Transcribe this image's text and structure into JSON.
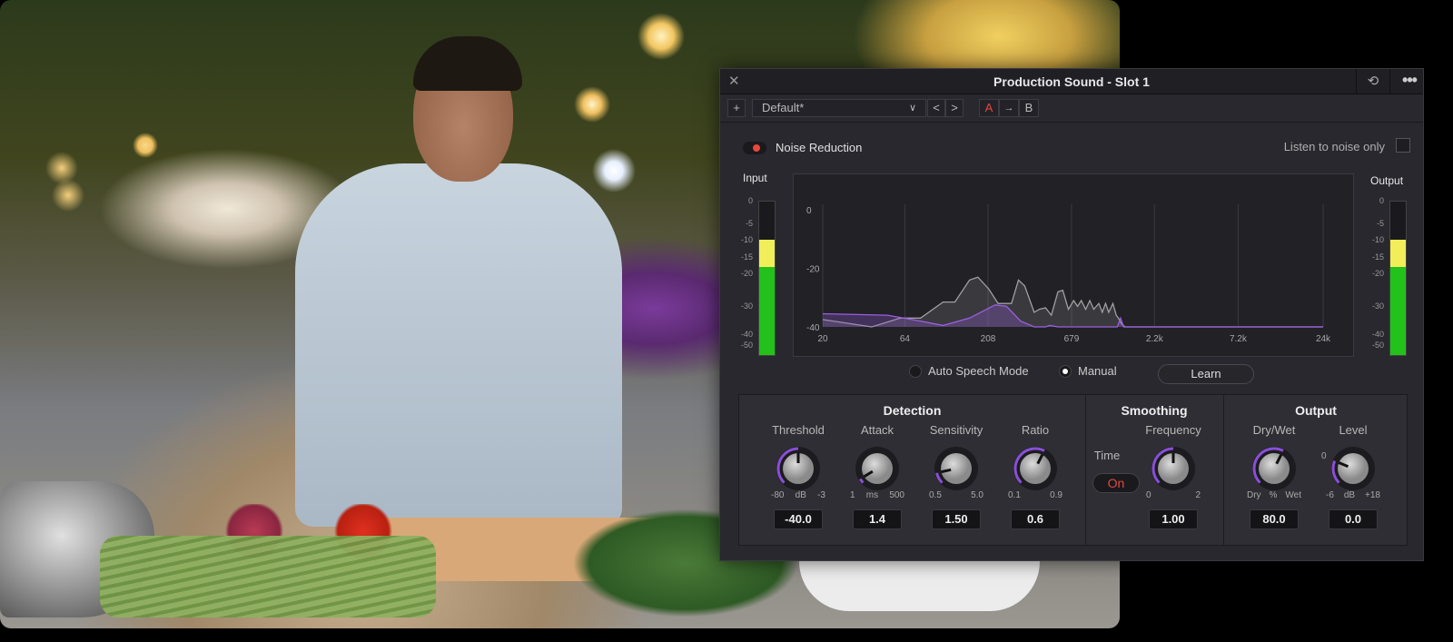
{
  "window": {
    "title": "Production Sound - Slot 1",
    "close_icon": "close-icon",
    "history_icon": "history-icon",
    "more_icon": "more-icon"
  },
  "toolbar": {
    "add": "+",
    "preset": "Default*",
    "prev": "<",
    "next": ">",
    "a": "A",
    "copy": "→",
    "b": "B"
  },
  "noise_reduction": {
    "label": "Noise Reduction",
    "enabled": true,
    "listen_label": "Listen to noise only",
    "listen_checked": false
  },
  "meters": {
    "input_label": "Input",
    "output_label": "Output",
    "scale": [
      "0",
      "-5",
      "-10",
      "-15",
      "-20",
      "-30",
      "-40",
      "-50"
    ],
    "input_level_db": -10,
    "output_level_db": -10,
    "colors": {
      "green": "#22c21a",
      "yellow": "#f2ee5a"
    }
  },
  "chart_data": {
    "type": "area",
    "x_scale": "log",
    "xlim": [
      20,
      24000
    ],
    "ylim": [
      -40,
      0
    ],
    "x_ticks": [
      "20",
      "64",
      "208",
      "679",
      "2.2k",
      "7.2k",
      "24k"
    ],
    "x_tick_values": [
      20,
      64,
      208,
      679,
      2200,
      7200,
      24000
    ],
    "y_ticks": [
      "0",
      "-20",
      "-40"
    ],
    "y_tick_values": [
      0,
      -20,
      -40
    ],
    "grid": true,
    "series": [
      {
        "color": "#a0a0a0",
        "points": [
          [
            20,
            -37.5
          ],
          [
            40,
            -40
          ],
          [
            60,
            -37
          ],
          [
            80,
            -37
          ],
          [
            110,
            -31.5
          ],
          [
            130,
            -31.5
          ],
          [
            160,
            -24
          ],
          [
            180,
            -23
          ],
          [
            210,
            -27
          ],
          [
            240,
            -32
          ],
          [
            290,
            -32
          ],
          [
            320,
            -24
          ],
          [
            350,
            -26
          ],
          [
            400,
            -35
          ],
          [
            430,
            -34
          ],
          [
            470,
            -33.5
          ],
          [
            510,
            -36
          ],
          [
            560,
            -28
          ],
          [
            600,
            -27.5
          ],
          [
            650,
            -34
          ],
          [
            700,
            -31
          ],
          [
            740,
            -33
          ],
          [
            780,
            -31
          ],
          [
            830,
            -34
          ],
          [
            880,
            -31
          ],
          [
            930,
            -34
          ],
          [
            1000,
            -32
          ],
          [
            1050,
            -35
          ],
          [
            1100,
            -32
          ],
          [
            1150,
            -35
          ],
          [
            1220,
            -32
          ],
          [
            1280,
            -36
          ],
          [
            1320,
            -37
          ],
          [
            1380,
            -39
          ],
          [
            1450,
            -40
          ],
          [
            24000,
            -40
          ]
        ]
      },
      {
        "color": "#9b5fe0",
        "points": [
          [
            20,
            -35.5
          ],
          [
            50,
            -36
          ],
          [
            80,
            -38
          ],
          [
            110,
            -39.5
          ],
          [
            160,
            -37
          ],
          [
            230,
            -32.5
          ],
          [
            270,
            -33
          ],
          [
            330,
            -38
          ],
          [
            400,
            -40
          ],
          [
            470,
            -40
          ],
          [
            500,
            -39.5
          ],
          [
            560,
            -40
          ],
          [
            1300,
            -40
          ],
          [
            1360,
            -37
          ],
          [
            1420,
            -40
          ],
          [
            24000,
            -40
          ]
        ]
      }
    ]
  },
  "modes": {
    "auto": "Auto Speech Mode",
    "manual": "Manual",
    "selected": "Manual",
    "learn": "Learn"
  },
  "sections": {
    "detection": "Detection",
    "smoothing": "Smoothing",
    "output": "Output"
  },
  "knobs": [
    {
      "label": "Threshold",
      "min": "-80",
      "unit": "dB",
      "max": "-3",
      "value": "-40.0",
      "fraction": 0.5
    },
    {
      "label": "Attack",
      "min": "1",
      "unit": "ms",
      "max": "500",
      "value": "1.4",
      "fraction": 0.05
    },
    {
      "label": "Sensitivity",
      "min": "0.5",
      "unit": "",
      "max": "5.0",
      "value": "1.50",
      "fraction": 0.12
    },
    {
      "label": "Ratio",
      "min": "0.1",
      "unit": "",
      "max": "0.9",
      "value": "0.6",
      "fraction": 0.6
    },
    {
      "label": "Frequency",
      "min": "0",
      "unit": "",
      "max": "2",
      "value": "1.00",
      "fraction": 0.5
    },
    {
      "label": "Dry/Wet",
      "min": "Dry",
      "unit": "%",
      "max": "Wet",
      "value": "80.0",
      "fraction": 0.6
    },
    {
      "label": "Level",
      "min": "-6",
      "unit": "dB",
      "max": "+18",
      "value": "0.0",
      "fraction": 0.25,
      "zero_label": "0"
    }
  ],
  "smoothing": {
    "time_label": "Time",
    "time_toggle": "On"
  },
  "accent": "#8a4fd8"
}
